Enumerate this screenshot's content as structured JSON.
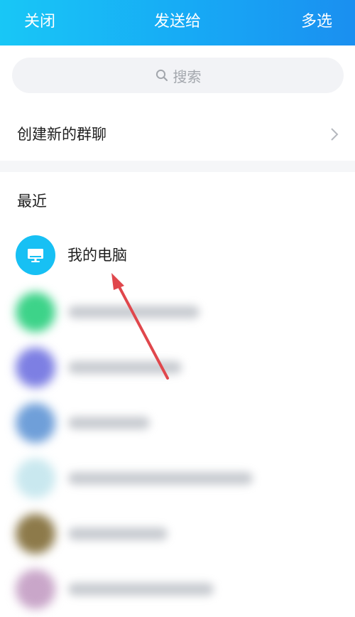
{
  "header": {
    "close_label": "关闭",
    "title": "发送给",
    "multi_select_label": "多选"
  },
  "search": {
    "placeholder": "搜索"
  },
  "create_group": {
    "label": "创建新的群聊"
  },
  "recent": {
    "section_title": "最近",
    "items": [
      {
        "name": "我的电脑",
        "icon": "monitor-icon"
      }
    ]
  },
  "colors": {
    "header_gradient_start": "#18c7f6",
    "header_gradient_end": "#1a8ff0",
    "pc_avatar": "#17c0f4",
    "annotation_arrow": "#e0474c",
    "blurred_avatars": [
      "#3dd389",
      "#7d7fe3",
      "#6f9fd9",
      "#c9e8ef",
      "#8d7a4a",
      "#c9a6c9"
    ]
  }
}
